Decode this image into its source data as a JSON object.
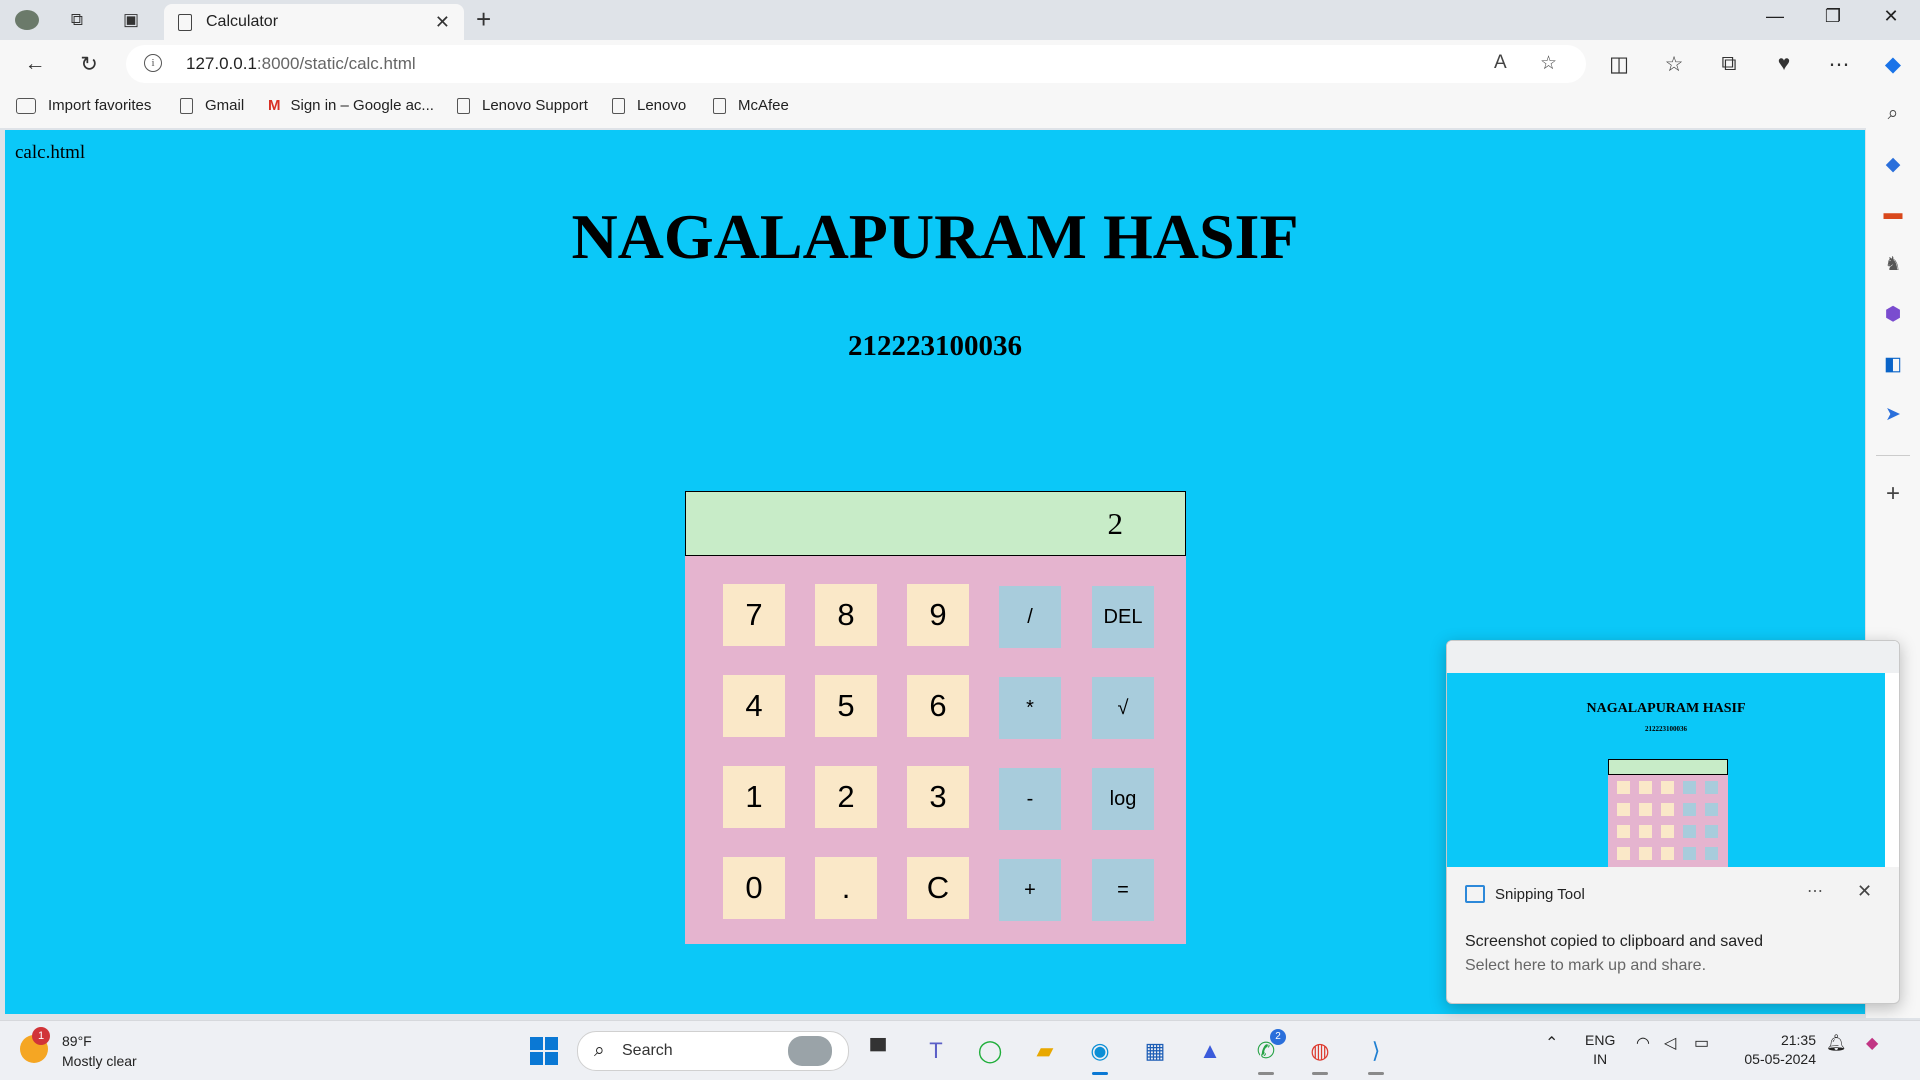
{
  "browser": {
    "tab_title": "Calculator",
    "url_host": "127.0.0.1",
    "url_rest": ":8000/static/calc.html",
    "bookmarks": [
      {
        "label": "Import favorites",
        "icon": "import-icon"
      },
      {
        "label": "Gmail",
        "icon": "page-icon"
      },
      {
        "label": "Sign in – Google ac...",
        "icon": "gmail-icon"
      },
      {
        "label": "Lenovo Support",
        "icon": "page-icon"
      },
      {
        "label": "Lenovo",
        "icon": "page-icon"
      },
      {
        "label": "McAfee",
        "icon": "page-icon"
      }
    ]
  },
  "page": {
    "filename": "calc.html",
    "heading": "NAGALAPURAM HASIF",
    "reg_no": "212223100036",
    "background": "#0bc8f8",
    "calculator": {
      "display": "2",
      "display_color": "#c8ecc8",
      "keypad_color": "#e5b4cf",
      "number_key_color": "#fae8c8",
      "operator_key_color": "#a8ccdc",
      "keys": [
        "7",
        "8",
        "9",
        "/",
        "DEL",
        "4",
        "5",
        "6",
        "*",
        "√",
        "1",
        "2",
        "3",
        "-",
        "log",
        "0",
        ".",
        "C",
        "+",
        "="
      ]
    }
  },
  "notification": {
    "app": "Snipping Tool",
    "message": "Screenshot copied to clipboard and saved",
    "sub_message": "Select here to mark up and share.",
    "thumb_title": "NAGALAPURAM HASIF",
    "thumb_subtitle": "212223100036"
  },
  "taskbar": {
    "weather_temp": "89°F",
    "weather_desc": "Mostly clear",
    "weather_badge": "1",
    "search_placeholder": "Search",
    "whatsapp_badge": "2",
    "lang_line1": "ENG",
    "lang_line2": "IN",
    "time": "21:35",
    "date": "05-05-2024"
  }
}
